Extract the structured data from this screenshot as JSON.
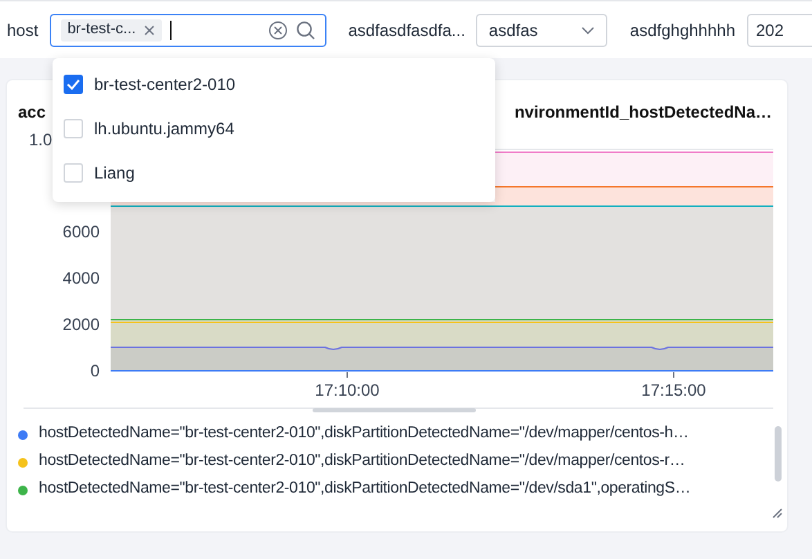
{
  "filters": [
    {
      "kind": "multiselect",
      "label": "host",
      "tags": [
        "br-test-c..."
      ]
    },
    {
      "kind": "select",
      "label": "asdfasdfasdfa...",
      "value": "asdfas"
    },
    {
      "kind": "input",
      "label": "asdfghghhhhh",
      "value": "202"
    }
  ],
  "dropdown": {
    "options": [
      {
        "label": "br-test-center2-010",
        "checked": true
      },
      {
        "label": "lh.ubuntu.jammy64",
        "checked": false
      },
      {
        "label": "Liang",
        "checked": false
      }
    ]
  },
  "panel": {
    "title_start": "acc",
    "title_end": "nvironmentId_hostDetectedNa…",
    "y_top_label": "1.0",
    "y_axis_labels": [
      "6000",
      "4000",
      "2000",
      "0"
    ],
    "x_axis_labels": [
      "17:10:00",
      "17:15:00"
    ],
    "legend": [
      {
        "label": "hostDetectedName=\"br-test-center2-010\",diskPartitionDetectedName=\"/dev/mapper/centos-h…",
        "color": "#3d7bf5"
      },
      {
        "label": "hostDetectedName=\"br-test-center2-010\",diskPartitionDetectedName=\"/dev/mapper/centos-r…",
        "color": "#f5c21b"
      },
      {
        "label": "hostDetectedName=\"br-test-center2-010\",diskPartitionDetectedName=\"/dev/sda1\",operatingS…",
        "color": "#3db44a"
      }
    ]
  }
}
